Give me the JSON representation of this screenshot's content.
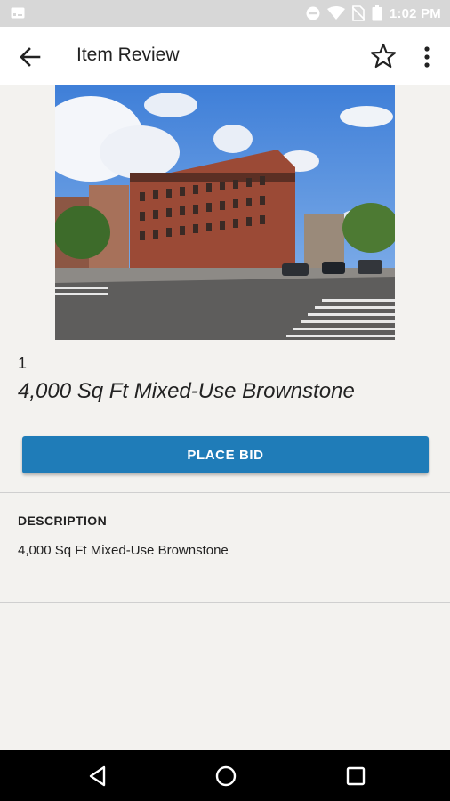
{
  "status_bar": {
    "time": "1:02 PM",
    "icons": [
      "image-notification-icon",
      "do-not-disturb-icon",
      "wifi-icon",
      "no-sim-icon",
      "battery-icon"
    ]
  },
  "app_bar": {
    "title": "Item Review",
    "back_icon": "arrow-left-icon",
    "favorite_icon": "star-outline-icon",
    "menu_icon": "more-vertical-icon"
  },
  "item": {
    "lot_number": "1",
    "title": "4,000 Sq Ft Mixed-Use Brownstone"
  },
  "bid": {
    "label": "PLACE BID",
    "color": "#1f7cb8"
  },
  "description": {
    "heading": "DESCRIPTION",
    "body": "4,000 Sq Ft Mixed-Use Brownstone"
  },
  "nav_bar": {
    "icons": [
      "back-triangle-icon",
      "home-circle-icon",
      "recents-square-icon"
    ]
  }
}
